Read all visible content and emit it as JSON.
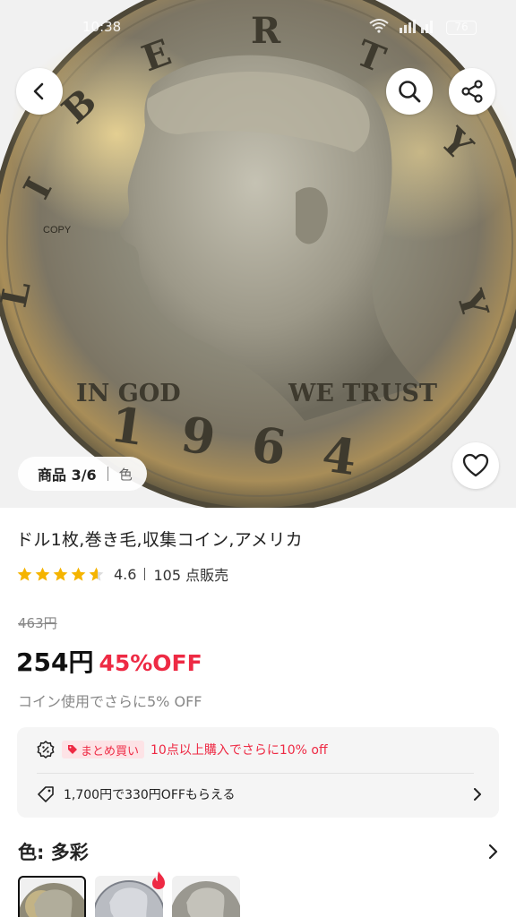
{
  "status_bar": {
    "time": "10:38",
    "battery": "76"
  },
  "hero": {
    "image_name": "kennedy-half-dollar-1964",
    "coin_text_top": "LIBERTY",
    "coin_text_left": "IN GOD",
    "coin_text_right": "WE TRUST",
    "coin_year": "1964",
    "watermark": "COPY",
    "counter": "商品 3/6",
    "color_tab": "色"
  },
  "product": {
    "title": "ドル1枚,巻き毛,収集コイン,アメリカ",
    "rating": "4.6",
    "sold": "105 点販売",
    "old_price": "463円",
    "price": "254円",
    "discount": "45%OFF",
    "coin_note": "コイン使用でさらに5% OFF"
  },
  "promo": {
    "bulk_badge": "まとめ買い",
    "bulk_text": "10点以上購入でさらに10% off",
    "coupon_text": "1,700円で330円OFFもらえる"
  },
  "color_selector": {
    "label": "色: 多彩"
  },
  "colors": {
    "accent": "#ee2a44",
    "star": "#f5b400"
  },
  "icons": [
    "back-arrow-icon",
    "search-icon",
    "share-icon",
    "heart-icon",
    "percent-badge-icon",
    "tag-icon",
    "chevron-right-icon",
    "fire-icon",
    "star-icon"
  ]
}
